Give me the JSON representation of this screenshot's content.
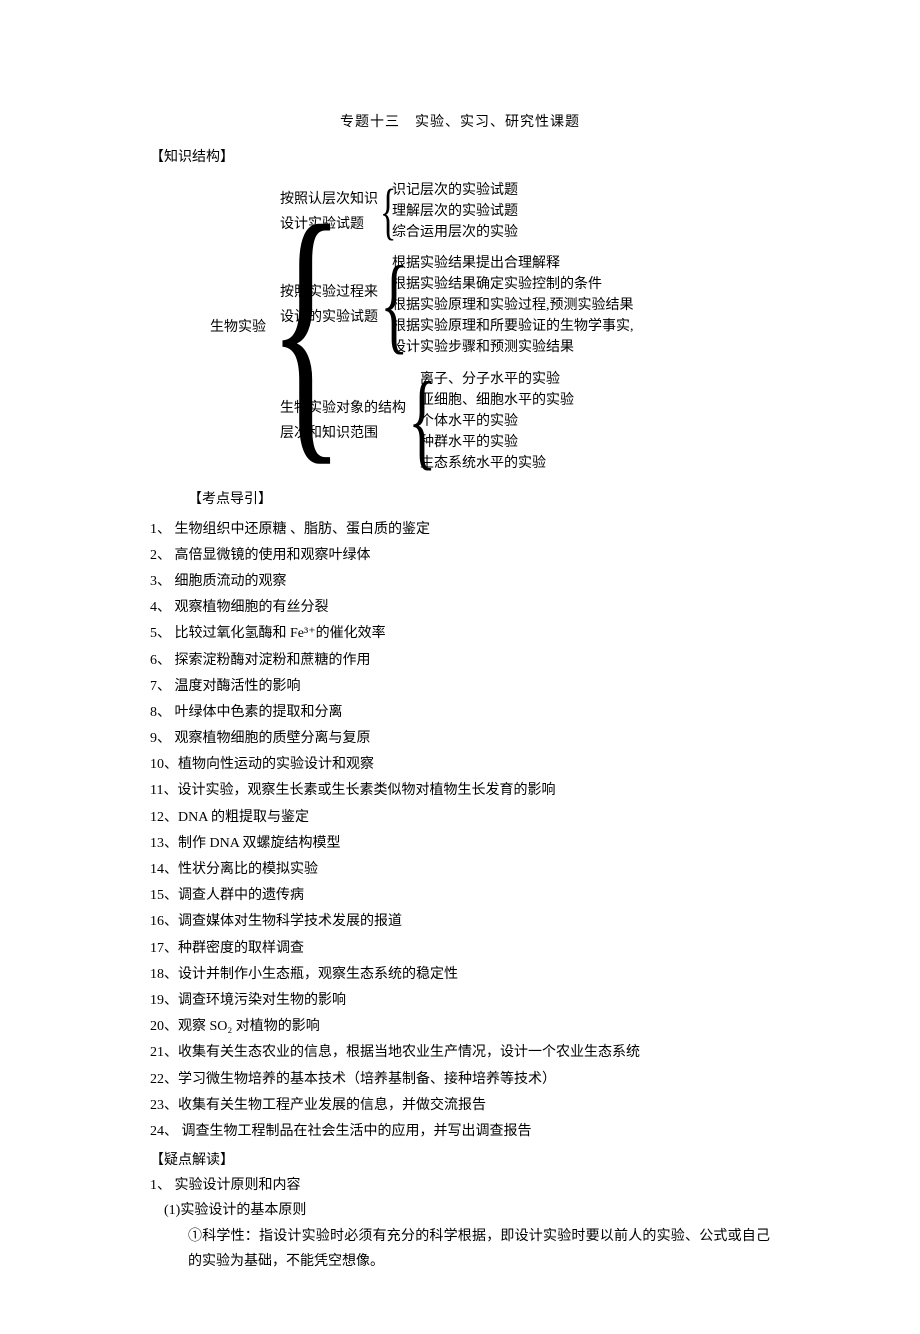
{
  "title": "专题十三　实验、实习、研究性课题",
  "section_knowledge": "【知识结构】",
  "diagram": {
    "root": "生物实验",
    "branches": [
      {
        "label": "按照认层次知识\n设计实验试题",
        "items": [
          "识记层次的实验试题",
          "理解层次的实验试题",
          "综合运用层次的实验"
        ]
      },
      {
        "label": "按照实验过程来\n设计的实验试题",
        "items": [
          "根据实验结果提出合理解释",
          "根据实验结果确定实验控制的条件",
          "根据实验原理和实验过程,预测实验结果",
          "根据实验原理和所要验证的生物学事实,",
          "设计实验步骤和预测实验结果"
        ]
      },
      {
        "label": "生物实验对象的结构\n层次和知识范围",
        "items": [
          "离子、分子水平的实验",
          "亚细胞、细胞水平的实验",
          "个体水平的实验",
          "种群水平的实验",
          "生态系统水平的实验"
        ]
      }
    ]
  },
  "section_guide": "【考点导引】",
  "guide_items": [
    "1、 生物组织中还原糖 、脂肪、蛋白质的鉴定",
    "2、 高倍显微镜的使用和观察叶绿体",
    "3、 细胞质流动的观察",
    "4、 观察植物细胞的有丝分裂",
    "5、 比较过氧化氢酶和 Fe³⁺的催化效率",
    "6、 探索淀粉酶对淀粉和蔗糖的作用",
    "7、 温度对酶活性的影响",
    "8、 叶绿体中色素的提取和分离",
    "9、 观察植物细胞的质壁分离与复原",
    "10、植物向性运动的实验设计和观察",
    "11、设计实验，观察生长素或生长素类似物对植物生长发育的影响",
    "12、DNA 的粗提取与鉴定",
    "13、制作 DNA 双螺旋结构模型",
    "14、性状分离比的模拟实验",
    "15、调查人群中的遗传病",
    "16、调查媒体对生物科学技术发展的报道",
    "17、种群密度的取样调查",
    "18、设计并制作小生态瓶，观察生态系统的稳定性",
    "19、调查环境污染对生物的影响",
    "20、观察 SO₂ 对植物的影响",
    "21、收集有关生态农业的信息，根据当地农业生产情况，设计一个农业生态系统",
    "22、学习微生物培养的基本技术（培养基制备、接种培养等技术）",
    "23、收集有关生物工程产业发展的信息，并做交流报告",
    "24、 调查生物工程制品在社会生活中的应用，并写出调查报告"
  ],
  "section_doubt": "【疑点解读】",
  "doubt": {
    "h1": "1、 实验设计原则和内容",
    "h2": "(1)实验设计的基本原则",
    "h3": "①科学性：指设计实验时必须有充分的科学根据，即设计实验时要以前人的实验、公式或自己的实验为基础，不能凭空想像。"
  }
}
